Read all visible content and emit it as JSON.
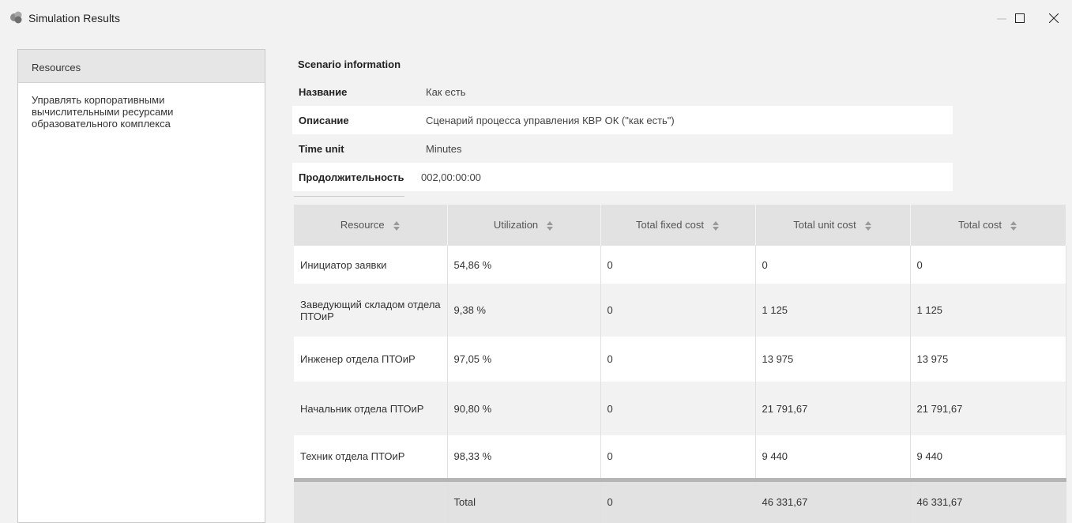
{
  "window": {
    "title": "Simulation Results",
    "icon": "app-icon"
  },
  "sidebar": {
    "tab_label": "Resources",
    "items": [
      {
        "label": "Управлять корпоративными вычислительными ресурсами образовательного комплекса"
      }
    ]
  },
  "scenario": {
    "title": "Scenario information",
    "fields": [
      {
        "label": "Название",
        "value": "Как есть"
      },
      {
        "label": "Описание",
        "value": "Сценарий процесса управления КВР ОК (\"как есть\")"
      },
      {
        "label": "Time unit",
        "value": "Minutes"
      },
      {
        "label": "Продолжительность",
        "value": "002,00:00:00"
      }
    ]
  },
  "table": {
    "headers": [
      "Resource",
      "Utilization",
      "Total fixed cost",
      "Total unit cost",
      "Total cost"
    ],
    "rows": [
      [
        "Инициатор заявки",
        "54,86 %",
        "0",
        "0",
        "0"
      ],
      [
        "Заведующий складом отдела ПТОиР",
        "9,38 %",
        "0",
        "1 125",
        "1 125"
      ],
      [
        "Инженер отдела ПТОиР",
        "97,05 %",
        "0",
        "13 975",
        "13 975"
      ],
      [
        "Начальник отдела ПТОиР",
        "90,80 %",
        "0",
        "21 791,67",
        "21 791,67"
      ],
      [
        "Техник отдела ПТОиР",
        "98,33 %",
        "0",
        "9 440",
        "9 440"
      ]
    ],
    "total": [
      "",
      "Total",
      "0",
      "46 331,67",
      "46 331,67"
    ]
  }
}
